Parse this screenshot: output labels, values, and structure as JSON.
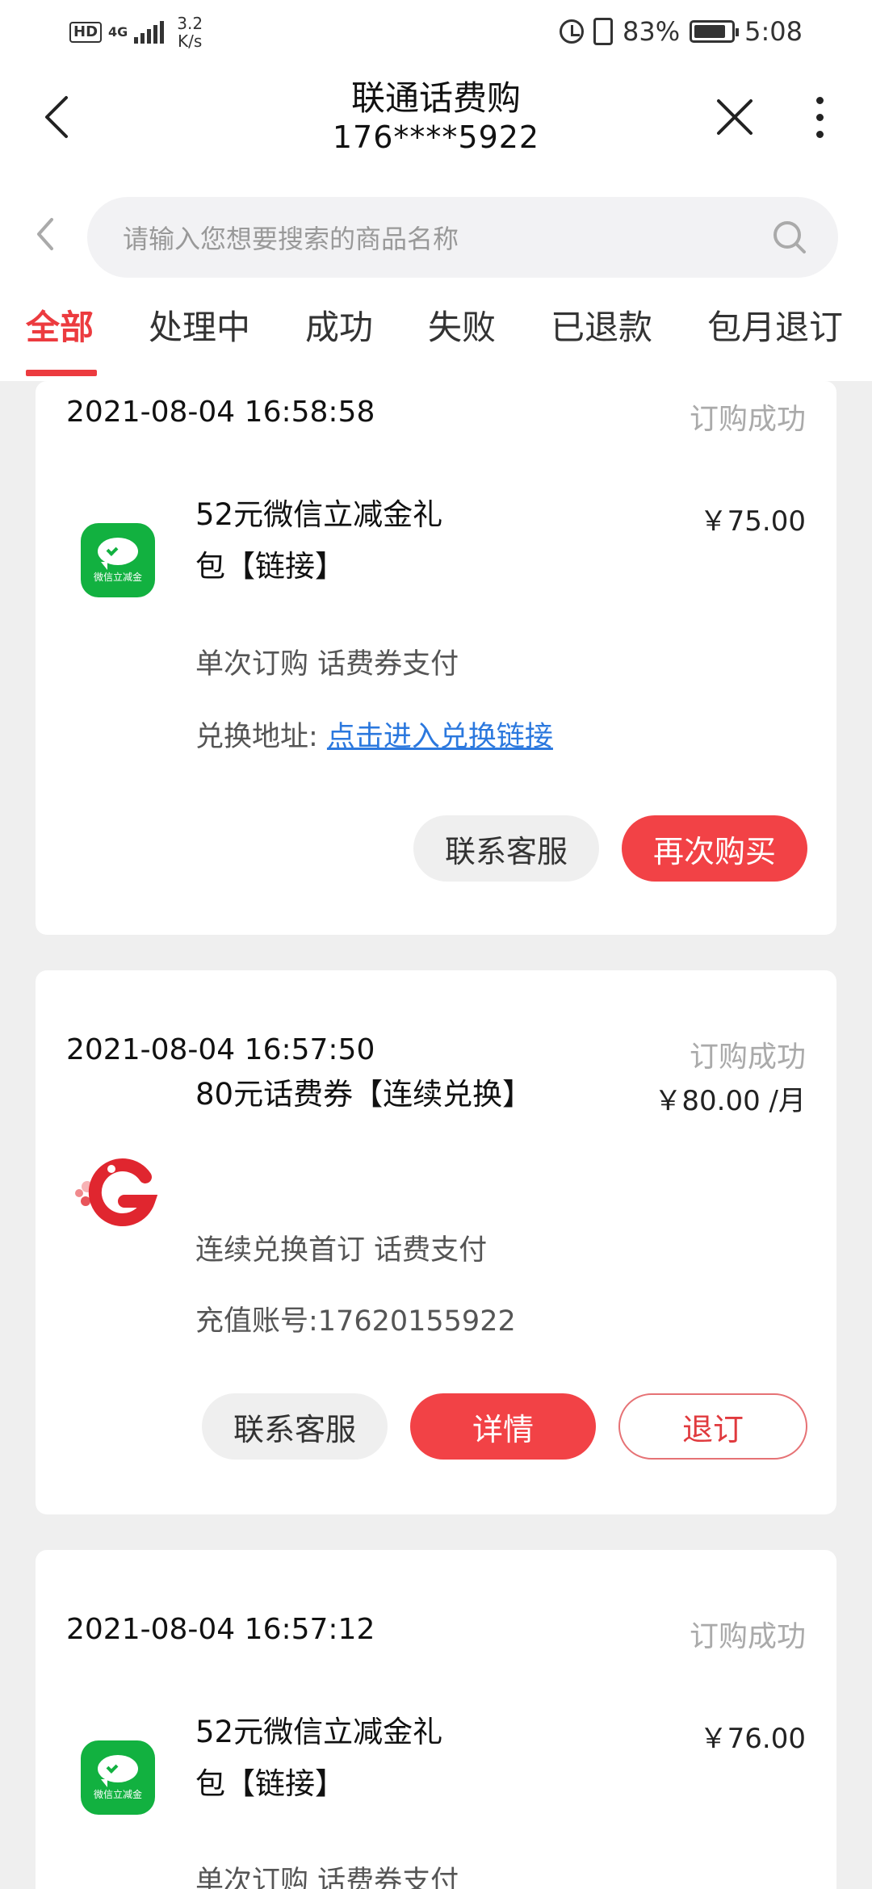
{
  "status_bar": {
    "hd": "HD",
    "network": "4G",
    "speed_value": "3.2",
    "speed_unit": "K/s",
    "battery": "83%",
    "time": "5:08",
    "icons": [
      "alarm-icon",
      "vibrate-icon",
      "battery-icon"
    ]
  },
  "header": {
    "title": "联通话费购",
    "phone": "176****5922"
  },
  "search": {
    "placeholder": "请输入您想要搜索的商品名称"
  },
  "tabs": [
    {
      "label": "全部",
      "active": true
    },
    {
      "label": "处理中",
      "active": false
    },
    {
      "label": "成功",
      "active": false
    },
    {
      "label": "失败",
      "active": false
    },
    {
      "label": "已退款",
      "active": false
    },
    {
      "label": "包月退订",
      "active": false
    }
  ],
  "orders": [
    {
      "time": "2021-08-04 16:58:58",
      "status": "订购成功",
      "logo": "wechat-voucher",
      "logo_text": "微信立减金",
      "name": "52元微信立减金礼包【链接】",
      "price": "￥75.00",
      "line1": "单次订购 话费券支付",
      "line2_label": "兑换地址: ",
      "line2_link": "点击进入兑换链接",
      "buttons": [
        "联系客服",
        "再次购买"
      ]
    },
    {
      "time": "2021-08-04 16:57:50",
      "status": "订购成功",
      "logo": "g-logo",
      "name": "80元话费券【连续兑换】",
      "price": "￥80.00 /月",
      "line1": "连续兑换首订 话费支付",
      "line2": "充值账号:17620155922",
      "buttons": [
        "联系客服",
        "详情",
        "退订"
      ]
    },
    {
      "time": "2021-08-04 16:57:12",
      "status": "订购成功",
      "logo": "wechat-voucher",
      "logo_text": "微信立减金",
      "name": "52元微信立减金礼包【链接】",
      "price": "￥76.00",
      "line1": "单次订购 话费券支付"
    }
  ],
  "colors": {
    "accent": "#ec3b3f",
    "wechat_green": "#12b140",
    "link": "#2b78de",
    "background": "#efefef"
  }
}
